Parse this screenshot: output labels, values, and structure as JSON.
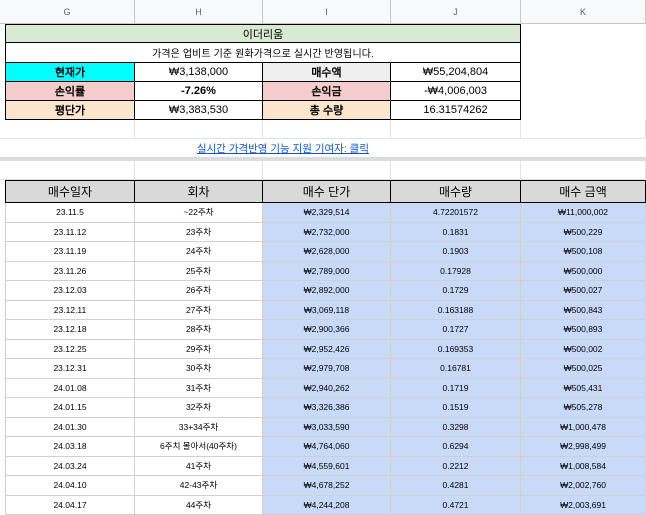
{
  "columns": [
    "G",
    "H",
    "I",
    "J",
    "K"
  ],
  "summary": {
    "title": "이더리움",
    "note": "가격은 업비트 기준 원화가격으로 실시간 반영됩니다.",
    "current_price_label": "현재가",
    "current_price": "₩3,138,000",
    "buy_total_label": "매수액",
    "buy_total": "₩55,204,804",
    "return_rate_label": "손익률",
    "return_rate": "-7.26%",
    "profit_label": "손익금",
    "profit": "-₩4,006,003",
    "avg_price_label": "평단가",
    "avg_price": "₩3,383,530",
    "total_qty_label": "총 수량",
    "total_qty": "16.31574262"
  },
  "link_text": "실시간 가격반영 기능 지원 기여자: 클릭",
  "table": {
    "headers": [
      "매수일자",
      "회차",
      "매수 단가",
      "매수량",
      "매수 금액"
    ],
    "rows": [
      [
        "23.11.5",
        "~22주차",
        "₩2,329,514",
        "4.72201572",
        "₩11,000,002"
      ],
      [
        "23.11.12",
        "23주차",
        "₩2,732,000",
        "0.1831",
        "₩500,229"
      ],
      [
        "23.11.19",
        "24주차",
        "₩2,628,000",
        "0.1903",
        "₩500,108"
      ],
      [
        "23.11.26",
        "25주차",
        "₩2,789,000",
        "0.17928",
        "₩500,000"
      ],
      [
        "23.12.03",
        "26주차",
        "₩2,892,000",
        "0.1729",
        "₩500,027"
      ],
      [
        "23.12.11",
        "27주차",
        "₩3,069,118",
        "0.163188",
        "₩500,843"
      ],
      [
        "23.12.18",
        "28주차",
        "₩2,900,366",
        "0.1727",
        "₩500,893"
      ],
      [
        "23.12.25",
        "29주차",
        "₩2,952,426",
        "0.169353",
        "₩500,002"
      ],
      [
        "23.12.31",
        "30주차",
        "₩2,979,708",
        "0.16781",
        "₩500,025"
      ],
      [
        "24.01.08",
        "31주차",
        "₩2,940,262",
        "0.1719",
        "₩505,431"
      ],
      [
        "24.01.15",
        "32주차",
        "₩3,326,386",
        "0.1519",
        "₩505,278"
      ],
      [
        "24.01.30",
        "33+34주차",
        "₩3,033,590",
        "0.3298",
        "₩1,000,478"
      ],
      [
        "24.03.18",
        "6주치 몰아서(40주차)",
        "₩4,764,060",
        "0.6294",
        "₩2,998,499"
      ],
      [
        "24.03.24",
        "41주차",
        "₩4,559,601",
        "0.2212",
        "₩1,008,584"
      ],
      [
        "24.04.10",
        "42-43주차",
        "₩4,678,252",
        "0.4281",
        "₩2,002,760"
      ],
      [
        "24.04.17",
        "44주차",
        "₩4,244,208",
        "0.4721",
        "₩2,003,691"
      ]
    ]
  },
  "colors": {
    "title_bg": "#d9ead3",
    "current_price_bg": "#00ffff",
    "return_bg": "#f4cccc",
    "avg_bg": "#fce5cd",
    "label_gray_bg": "#efefef",
    "header_bg": "#d9d9d9",
    "price_col_bg": "#c9daf8",
    "link_color": "#1155cc"
  }
}
